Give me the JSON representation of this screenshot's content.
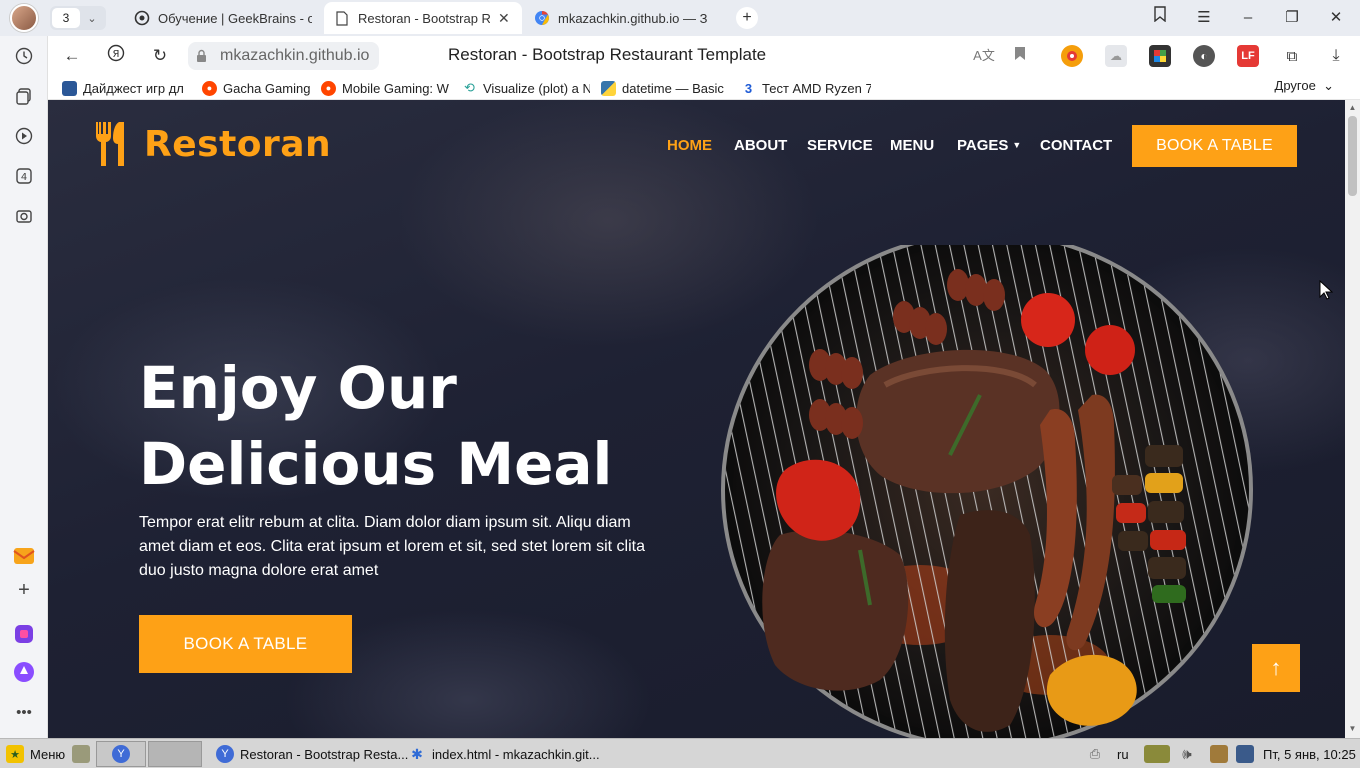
{
  "tabbar": {
    "tab_count": "3",
    "tabs": [
      {
        "label": "Обучение | GeekBrains - о",
        "active": false
      },
      {
        "label": "Restoran - Bootstrap Res",
        "active": true
      },
      {
        "label": "mkazachkin.github.io — З",
        "active": false
      }
    ]
  },
  "address": {
    "host": "mkazachkin.github.io",
    "page_title": "Restoran - Bootstrap Restaurant Template"
  },
  "bookmarks": {
    "items": [
      {
        "label": "Дайджест игр дл",
        "color": "#2b5797"
      },
      {
        "label": "Gacha Gaming",
        "color": "#ff4500"
      },
      {
        "label": "Mobile Gaming: W",
        "color": "#ff4500"
      },
      {
        "label": "Visualize (plot) a N",
        "color": "#2aa198"
      },
      {
        "label": "datetime — Basic",
        "color": "#3776ab"
      },
      {
        "label": "Тест AMD Ryzen 7",
        "color": "#1e5bd6"
      }
    ],
    "other": "Другое"
  },
  "site": {
    "logo": "Restoran",
    "nav": [
      "HOME",
      "ABOUT",
      "SERVICE",
      "MENU",
      "PAGES",
      "CONTACT"
    ],
    "active_nav": "HOME",
    "book_button": "BOOK A TABLE",
    "hero_title_line1": "Enjoy Our",
    "hero_title_line2": "Delicious Meal",
    "hero_text": "Tempor erat elitr rebum at clita. Diam dolor diam ipsum sit. Aliqu diam amet diam et eos. Clita erat ipsum et lorem et sit, sed stet lorem sit clita duo justo magna dolore erat amet",
    "hero_button": "BOOK A TABLE",
    "back_to_top": "↑",
    "accent_color": "#fea116"
  },
  "taskbar": {
    "menu_label": "Меню",
    "windows": [
      "Restoran - Bootstrap Resta...",
      "index.html - mkazachkin.git..."
    ],
    "lang": "ru",
    "clock": "Пт, 5 янв, 10:25"
  }
}
